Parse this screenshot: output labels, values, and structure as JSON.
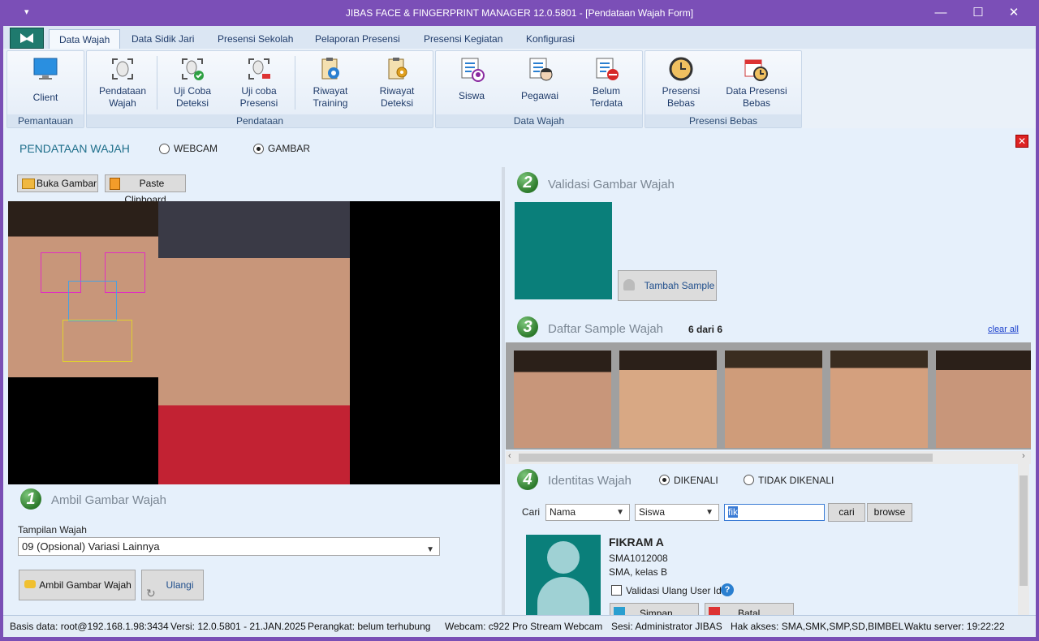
{
  "window": {
    "title": "JIBAS FACE & FINGERPRINT MANAGER 12.0.5801 - [Pendataan Wajah Form]",
    "minimize": "—",
    "maximize": "☐",
    "close": "✕",
    "sysmenu": "▾"
  },
  "tabs": [
    "Data Wajah",
    "Data Sidik Jari",
    "Presensi Sekolah",
    "Pelaporan Presensi",
    "Presensi Kegiatan",
    "Konfigurasi"
  ],
  "ribbon": {
    "groups": {
      "pemantauan": "Pemantauan",
      "pendataan": "Pendataan",
      "data_wajah": "Data Wajah",
      "presensi_bebas": "Presensi Bebas"
    },
    "buttons": {
      "client": "Client",
      "pendataan_wajah": "Pendataan\nWajah",
      "uji_coba_deteksi": "Uji Coba\nDeteksi",
      "uji_coba_presensi": "Uji coba\nPresensi",
      "riwayat_training": "Riwayat\nTraining",
      "riwayat_deteksi": "Riwayat\nDeteksi",
      "siswa": "Siswa",
      "pegawai": "Pegawai",
      "belum_terdata": "Belum\nTerdata",
      "presensi_bebas": "Presensi\nBebas",
      "data_presensi_bebas": "Data Presensi\nBebas"
    }
  },
  "form": {
    "heading": "PENDATAAN WAJAH",
    "source_webcam": "WEBCAM",
    "source_gambar": "GAMBAR",
    "source_selected": "GAMBAR",
    "open_image": "Buka Gambar",
    "paste_clipboard": "Paste Clipboard"
  },
  "step1": {
    "number": "1",
    "title": "Ambil Gambar Wajah",
    "view_label": "Tampilan Wajah",
    "view_value": "09 (Opsional) Variasi Lainnya",
    "take_button": "Ambil Gambar Wajah",
    "retry_button": "Ulangi"
  },
  "step2": {
    "number": "2",
    "title": "Validasi Gambar Wajah",
    "add_sample": "Tambah Sample",
    "preview_color": "#0a7f7a"
  },
  "step3": {
    "number": "3",
    "title": "Daftar Sample Wajah",
    "count": "6 dari 6",
    "clear_all": "clear all"
  },
  "step4": {
    "number": "4",
    "title": "Identitas Wajah",
    "dikenali": "DIKENALI",
    "tidak_dikenali": "TIDAK DIKENALI",
    "selected": "DIKENALI",
    "search_label": "Cari",
    "field_select": "Nama",
    "type_select": "Siswa",
    "search_value": "fik",
    "search_button": "cari",
    "browse_button": "browse",
    "person_name": "FIKRAM A",
    "person_id": "SMA1012008",
    "person_class": "SMA, kelas B",
    "revalidate": "Validasi Ulang User Id",
    "help": "?",
    "save_button": "Simpan",
    "cancel_button": "Batal"
  },
  "status": {
    "db": "Basis data: root@192.168.1.98:3434",
    "version": "Versi: 12.0.5801 - 21.JAN.2025",
    "device": "Perangkat: belum terhubung",
    "webcam": "Webcam: c922 Pro Stream Webcam",
    "session": "Sesi: Administrator JIBAS",
    "access": "Hak akses: SMA,SMK,SMP,SD,BIMBEL",
    "server_time": "Waktu server: 19:22:22"
  }
}
